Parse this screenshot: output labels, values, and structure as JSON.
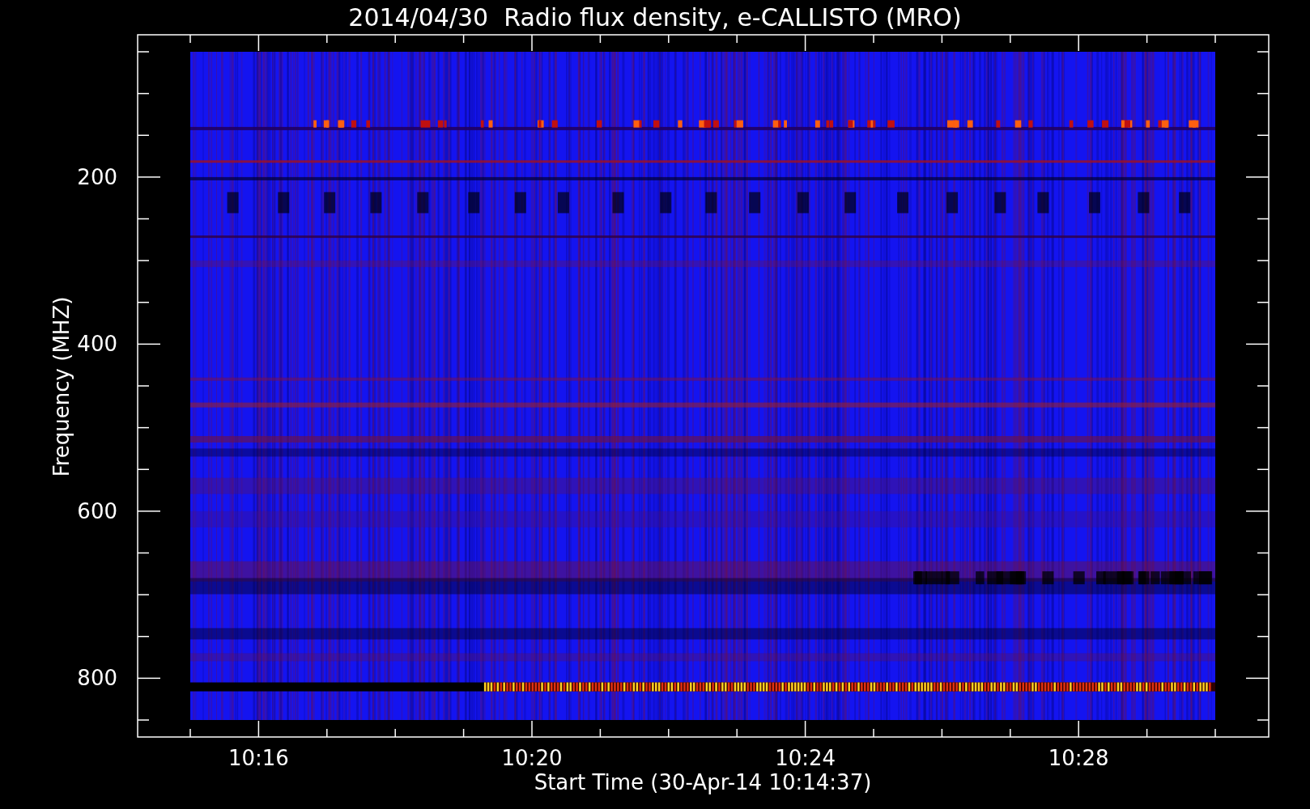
{
  "title": "2014/04/30  Radio flux density, e-CALLISTO (MRO)",
  "xlabel": "Start Time (30-Apr-14 10:14:37)",
  "ylabel": "Frequency (MHZ)",
  "xtick_labels": [
    "10:16",
    "10:20",
    "10:24",
    "10:28"
  ],
  "ytick_labels": [
    "200",
    "400",
    "600",
    "800"
  ]
}
